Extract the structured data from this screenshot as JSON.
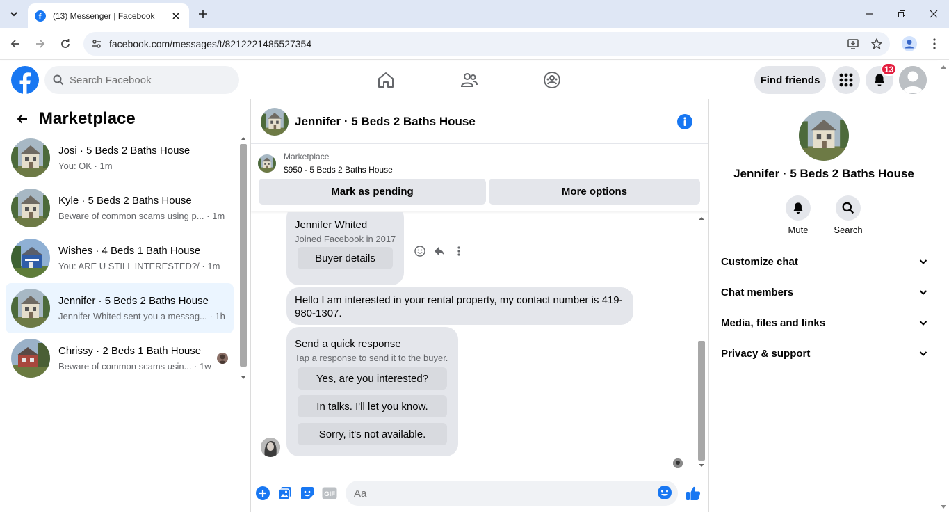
{
  "browser": {
    "tab_title": "(13) Messenger | Facebook",
    "url": "facebook.com/messages/t/8212221485527354"
  },
  "fb_header": {
    "search_placeholder": "Search Facebook",
    "find_friends": "Find friends",
    "notification_count": "13"
  },
  "left_panel": {
    "title": "Marketplace",
    "conversations": [
      {
        "name": "Josi · 5 Beds 2 Baths House",
        "preview": "You: OK · 1m"
      },
      {
        "name": "Kyle · 5 Beds 2 Baths House",
        "preview": "Beware of common scams using p... · 1m"
      },
      {
        "name": "Wishes · 4 Beds 1 Bath House",
        "preview": "You: ARE U STILL INTERESTED?/ · 1m"
      },
      {
        "name": "Jennifer · 5 Beds 2 Baths House",
        "preview": "Jennifer Whited sent you a messag... · 1h"
      },
      {
        "name": "Chrissy · 2 Beds 1 Bath House",
        "preview": "Beware of common scams usin... · 1w"
      }
    ]
  },
  "chat": {
    "title": "Jennifer · 5 Beds 2 Baths House",
    "marketplace_label": "Marketplace",
    "listing_price": "$950 - 5 Beds 2 Baths House",
    "mark_pending": "Mark as pending",
    "more_options": "More options",
    "buyer_name": "Jennifer Whited",
    "buyer_joined": "Joined Facebook in 2017",
    "buyer_details": "Buyer details",
    "message": "Hello I am interested in your rental property, my contact number is 419-980-1307.",
    "quick_title": "Send a quick response",
    "quick_sub": "Tap a response to send it to the buyer.",
    "quick_responses": [
      "Yes, are you interested?",
      "In talks. I'll let you know.",
      "Sorry, it's not available."
    ],
    "composer_placeholder": "Aa"
  },
  "right_panel": {
    "name": "Jennifer · 5 Beds 2 Baths House",
    "mute": "Mute",
    "search": "Search",
    "sections": [
      "Customize chat",
      "Chat members",
      "Media, files and links",
      "Privacy & support"
    ]
  },
  "colors": {
    "fb_blue": "#1877f2",
    "badge_red": "#e41e3f",
    "active_row": "#ebf5ff",
    "bubble_gray": "#e4e6eb"
  }
}
